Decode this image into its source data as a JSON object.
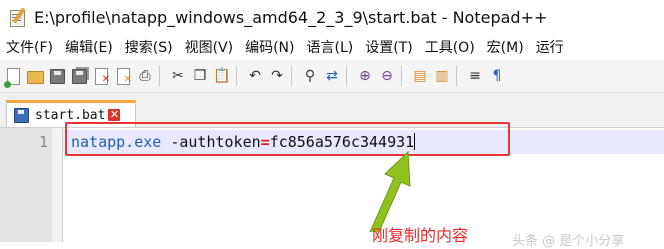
{
  "window": {
    "title": "E:\\profile\\natapp_windows_amd64_2_3_9\\start.bat - Notepad++"
  },
  "menu": {
    "items": [
      "文件(F)",
      "编辑(E)",
      "搜索(S)",
      "视图(V)",
      "编码(N)",
      "语言(L)",
      "设置(T)",
      "工具(O)",
      "宏(M)",
      "运行"
    ]
  },
  "toolbar": {
    "icons": [
      "new-file",
      "open-folder",
      "save",
      "save-all",
      "close",
      "close-all",
      "print",
      "cut",
      "copy",
      "paste",
      "undo",
      "redo",
      "find",
      "replace",
      "zoom-in",
      "zoom-out",
      "sync-vertical",
      "sync-horizontal",
      "word-wrap",
      "show-all-chars"
    ]
  },
  "tab": {
    "label": "start.bat",
    "close": "✕"
  },
  "editor": {
    "line_number": "1",
    "code": {
      "cmd": "natapp.exe",
      "opt": " -authtoken",
      "eq": "=",
      "val": "fc856a576c344931"
    }
  },
  "annotation": {
    "text": "刚复制的内容",
    "color": "#ee2a2a",
    "arrow_color": "#8fc21f"
  },
  "watermark": {
    "text": "头条 @ 是个小分享"
  }
}
